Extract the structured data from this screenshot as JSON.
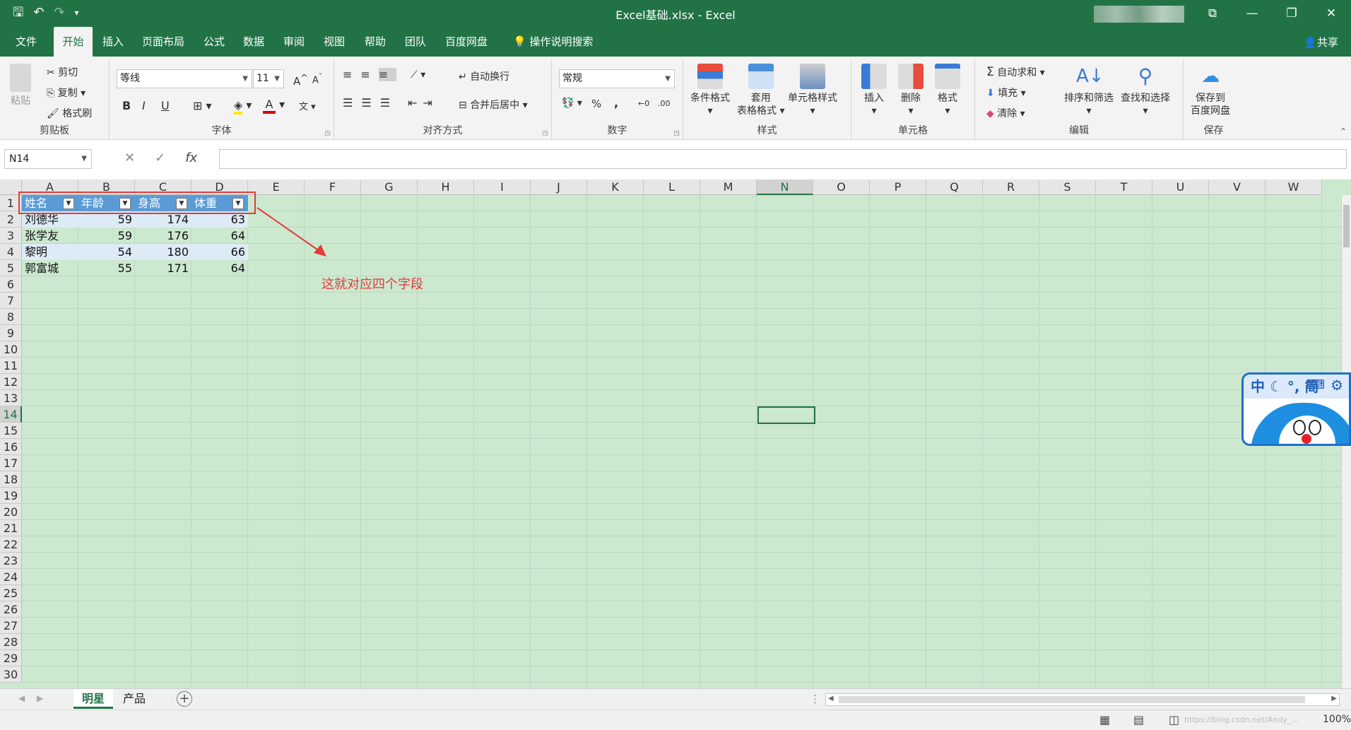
{
  "window": {
    "title": "Excel基础.xlsx  -  Excel"
  },
  "qat": {
    "save_icon": "save-icon",
    "undo_icon": "undo-icon",
    "redo_icon": "redo-icon",
    "customize_icon": "customize-icon"
  },
  "tabs": [
    "文件",
    "开始",
    "插入",
    "页面布局",
    "公式",
    "数据",
    "审阅",
    "视图",
    "帮助",
    "团队",
    "百度网盘"
  ],
  "tell_me": "操作说明搜索",
  "share": "共享",
  "ribbon": {
    "clipboard": {
      "paste": "粘贴",
      "cut": "剪切",
      "copy": "复制",
      "format_painter": "格式刷",
      "label": "剪贴板"
    },
    "font": {
      "name": "等线",
      "size": "11",
      "label": "字体",
      "bold": "B",
      "italic": "I",
      "underline": "U",
      "wen": "文",
      "font_color_label": "A"
    },
    "alignment": {
      "wrap": "自动换行",
      "merge": "合并后居中",
      "label": "对齐方式"
    },
    "number": {
      "format": "常规",
      "percent": "%",
      "comma": ",",
      "label": "数字"
    },
    "styles": {
      "conditional": "条件格式",
      "table1": "套用",
      "table2": "表格格式",
      "cell_styles": "单元格样式",
      "label": "样式"
    },
    "cells": {
      "insert": "插入",
      "delete": "删除",
      "format": "格式",
      "label": "单元格"
    },
    "editing": {
      "autosum": "自动求和",
      "fill": "填充",
      "clear": "清除",
      "sort": "排序和筛选",
      "find": "查找和选择",
      "label": "编辑"
    },
    "save": {
      "line1": "保存到",
      "line2": "百度网盘",
      "label": "保存"
    }
  },
  "formula_bar": {
    "name_box": "N14",
    "fx": "fx",
    "formula": ""
  },
  "sheet": {
    "columns": [
      "A",
      "B",
      "C",
      "D",
      "E",
      "F",
      "G",
      "H",
      "I",
      "J",
      "K",
      "L",
      "M",
      "N",
      "O",
      "P",
      "Q",
      "R",
      "S",
      "T",
      "U",
      "V",
      "W"
    ],
    "rows": [
      "1",
      "2",
      "3",
      "4",
      "5",
      "6",
      "7",
      "8",
      "9",
      "10",
      "11",
      "12",
      "13",
      "14",
      "15",
      "16",
      "17",
      "18",
      "19",
      "20",
      "21",
      "22",
      "23",
      "24",
      "25",
      "26",
      "27",
      "28",
      "29",
      "30"
    ],
    "selected_column": "N",
    "selected_row": "14",
    "table": {
      "headers": [
        "姓名",
        "年龄",
        "身高",
        "体重"
      ],
      "rows": [
        [
          "刘德华",
          "59",
          "174",
          "63"
        ],
        [
          "张学友",
          "59",
          "176",
          "64"
        ],
        [
          "黎明",
          "54",
          "180",
          "66"
        ],
        [
          "郭富城",
          "55",
          "171",
          "64"
        ]
      ]
    },
    "annotation": "这就对应四个字段"
  },
  "sheet_tabs": [
    "明星",
    "产品"
  ],
  "active_sheet": "明星",
  "status": {
    "zoom": "100%",
    "watermark": "https://blog.csdn.net/Andy_..."
  },
  "ime": {
    "text": "中 ☾ °, 简"
  },
  "colors": {
    "accent": "#217346",
    "table_header": "#5b9bd5",
    "band": "#ddebf7",
    "annotation": "#e23b3b",
    "sheet_bg": "#cce8cf"
  }
}
